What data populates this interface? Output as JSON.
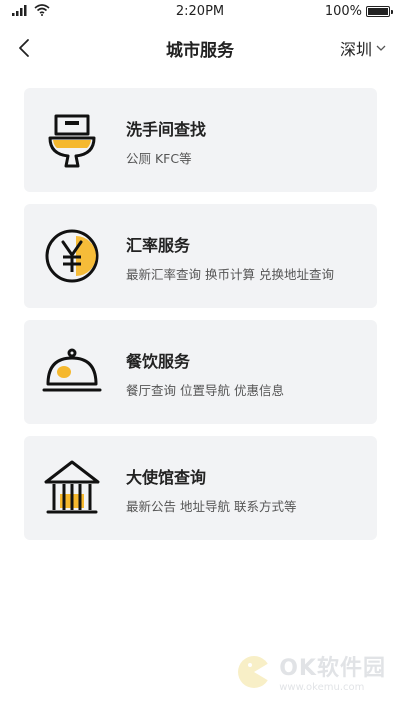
{
  "status_bar": {
    "time": "2:20PM",
    "battery": "100%",
    "icons": [
      "signal-icon",
      "wifi-icon",
      "battery-icon"
    ]
  },
  "nav": {
    "title": "城市服务",
    "city": "深圳",
    "icons": [
      "back-arrow-icon",
      "chevron-down-icon"
    ]
  },
  "cards": [
    {
      "title": "洗手间查找",
      "desc": "公厕 KFC等",
      "icon": "toilet-icon"
    },
    {
      "title": "汇率服务",
      "desc": "最新汇率查询 换币计算 兑换地址查询",
      "icon": "yen-coin-icon"
    },
    {
      "title": "餐饮服务",
      "desc": "餐厅查询 位置导航 优惠信息",
      "icon": "food-cloche-icon"
    },
    {
      "title": "大使馆查询",
      "desc": "最新公告 地址导航 联系方式等",
      "icon": "embassy-building-icon"
    }
  ],
  "watermark": {
    "brand": "OK软件园",
    "url": "www.okemu.com"
  },
  "colors": {
    "accent": "#f5b82e",
    "card_bg": "#f2f3f5",
    "text": "#222222",
    "subtext": "#555555"
  }
}
